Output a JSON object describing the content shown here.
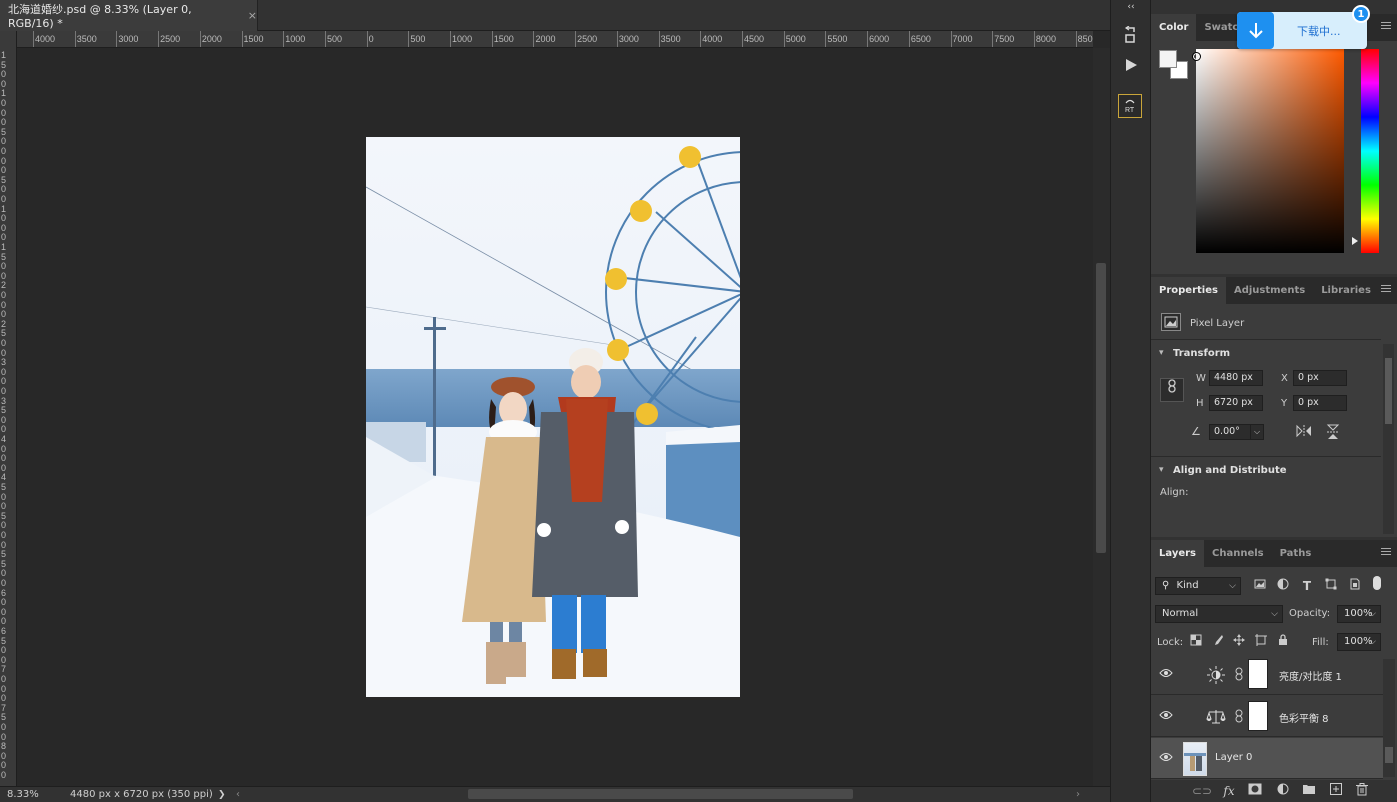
{
  "document": {
    "tab_title": "北海道婚纱.psd @ 8.33% (Layer 0, RGB/16) *",
    "close_glyph": "×"
  },
  "ruler": {
    "h_labels": [
      "4000",
      "3500",
      "3000",
      "2500",
      "2000",
      "1500",
      "1000",
      "500",
      "0",
      "500",
      "1000",
      "1500",
      "2000",
      "2500",
      "3000",
      "3500",
      "4000",
      "4500",
      "5000",
      "5500",
      "6000",
      "6500",
      "7000",
      "7500",
      "8000",
      "850"
    ],
    "v_labels": [
      "1",
      "5",
      "0",
      "0",
      "1",
      "0",
      "0",
      "0",
      "5",
      "0",
      "0",
      "0",
      "0",
      "5",
      "0",
      "0",
      "1",
      "0",
      "0",
      "0",
      "1",
      "5",
      "0",
      "0",
      "2",
      "0",
      "0",
      "0",
      "2",
      "5",
      "0",
      "0",
      "3",
      "0",
      "0",
      "0",
      "3",
      "5",
      "0",
      "0",
      "4",
      "0",
      "0",
      "0",
      "4",
      "5",
      "0",
      "0",
      "5",
      "0",
      "0",
      "0",
      "5",
      "5",
      "0",
      "0",
      "6",
      "0",
      "0",
      "0",
      "6",
      "5",
      "0",
      "0",
      "7",
      "0",
      "0",
      "0",
      "7",
      "5",
      "0",
      "0",
      "8",
      "0",
      "0",
      "0"
    ]
  },
  "status": {
    "zoom": "8.33%",
    "doc_info": "4480 px x 6720 px (350 ppi)",
    "arrow": "❯"
  },
  "download": {
    "label": "下载中...",
    "count": "1"
  },
  "color_panel": {
    "tabs": [
      "Color",
      "Swatche"
    ],
    "active_tab": "Color"
  },
  "properties_panel": {
    "tabs": [
      "Properties",
      "Adjustments",
      "Libraries"
    ],
    "layer_kind": "Pixel Layer",
    "transform_title": "Transform",
    "w_label": "W",
    "h_label": "H",
    "x_label": "X",
    "y_label": "Y",
    "w_value": "4480 px",
    "h_value": "6720 px",
    "x_value": "0 px",
    "y_value": "0 px",
    "angle_value": "0.00°",
    "align_title": "Align and Distribute",
    "align_label": "Align:"
  },
  "layers_panel": {
    "tabs": [
      "Layers",
      "Channels",
      "Paths"
    ],
    "kind_label": "Kind",
    "blend_mode": "Normal",
    "opacity_label": "Opacity:",
    "opacity_value": "100%",
    "lock_label": "Lock:",
    "fill_label": "Fill:",
    "fill_value": "100%",
    "layers": [
      {
        "name": "亮度/对比度 1",
        "type": "adjustment",
        "icon": "brightness-icon"
      },
      {
        "name": "色彩平衡 8",
        "type": "adjustment",
        "icon": "balance-icon"
      },
      {
        "name": "Layer 0",
        "type": "pixel",
        "selected": true
      }
    ]
  },
  "colors": {
    "accent_blue": "#1e90f0",
    "panel_bg": "#3c3c3c",
    "selected_layer": "#525252"
  }
}
